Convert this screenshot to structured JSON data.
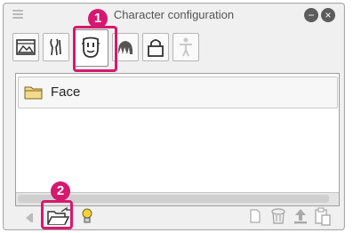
{
  "window": {
    "title": "Character configuration",
    "minimize_icon": "circle-minus-icon",
    "close_icon": "circle-close-icon"
  },
  "tabs": [
    {
      "name": "scene-icon",
      "active": false
    },
    {
      "name": "body-shape-icon",
      "active": false
    },
    {
      "name": "face-icon",
      "active": true
    },
    {
      "name": "hair-icon",
      "active": false
    },
    {
      "name": "lock-icon",
      "active": false
    },
    {
      "name": "figure-icon",
      "active": false
    }
  ],
  "list": {
    "items": [
      {
        "label": "Face",
        "icon": "folder-icon"
      }
    ]
  },
  "bottom_toolbar": {
    "left": [
      "back-arrow-icon",
      "open-folder-icon",
      "lightbulb-icon"
    ],
    "right": [
      "new-page-icon",
      "delete-icon",
      "upload-icon",
      "paste-icon"
    ]
  },
  "annotations": [
    {
      "number": "1"
    },
    {
      "number": "2"
    }
  ],
  "colors": {
    "highlight": "#d6186f"
  }
}
